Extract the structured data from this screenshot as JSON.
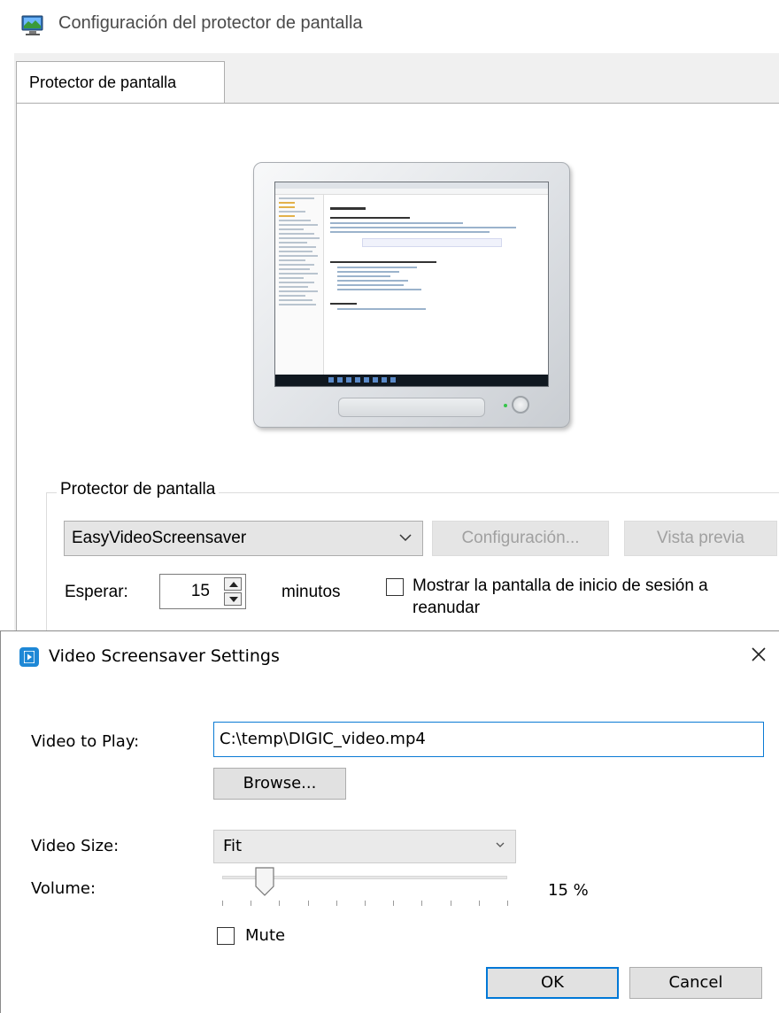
{
  "window": {
    "title": "Configuración del protector de pantalla",
    "icon": "screen-saver-monitor-icon"
  },
  "tabs": [
    {
      "label": "Protector de pantalla",
      "selected": true
    }
  ],
  "screensaver": {
    "group_label": "Protector de pantalla",
    "selected": "EasyVideoScreensaver",
    "settings_button": "Configuración...",
    "preview_button": "Vista previa",
    "wait_label": "Esperar:",
    "wait_value": "15",
    "wait_unit": "minutos",
    "resume_checkbox_line1": "Mostrar la pantalla de inicio de sesión a",
    "resume_checkbox_line2": "reanudar",
    "resume_checked": false
  },
  "settings_dialog": {
    "title": "Video Screensaver Settings",
    "close_glyph": "×",
    "video_label": "Video to Play:",
    "video_path": "C:\\temp\\DIGIC_video.mp4",
    "browse_button": "Browse...",
    "size_label": "Video Size:",
    "size_value": "Fit",
    "volume_label": "Volume:",
    "volume_value": 15,
    "volume_text": "15 %",
    "mute_label": "Mute",
    "mute_checked": false,
    "ok_button": "OK",
    "cancel_button": "Cancel"
  }
}
